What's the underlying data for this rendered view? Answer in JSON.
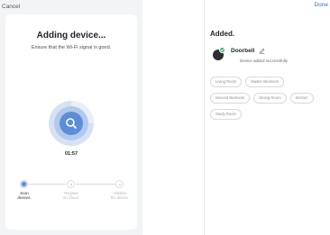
{
  "left_screen": {
    "cancel_label": "Cancel",
    "title": "Adding device...",
    "subtitle": "Ensure that the Wi-Fi signal is good.",
    "timer": "01:57",
    "progress_icon": "search-icon",
    "steps": [
      {
        "label_line1": "Scan",
        "label_line2": "devices.",
        "state": "active"
      },
      {
        "label_line1": "Register",
        "label_line2": "on Cloud.",
        "state": "pending"
      },
      {
        "label_line1": "Initialize",
        "label_line2": "the device.",
        "state": "pending"
      }
    ],
    "colors": {
      "accent": "#5b8ed6",
      "ring_outer": "#c7d7ef",
      "ring_inner": "#7aa3de"
    }
  },
  "right_screen": {
    "done_label": "Done",
    "added_title": "Added.",
    "device": {
      "name": "Doorbell",
      "status": "Device added successfully",
      "icon": "doorbell-icon",
      "badge_icon": "check-icon"
    },
    "rooms": [
      [
        "Living Room",
        "Master Bedroom"
      ],
      [
        "Second Bedroom",
        "Dining Room",
        "Kitchen"
      ],
      [
        "Study Room"
      ]
    ],
    "colors": {
      "link": "#3b6fd4",
      "success": "#2fb36b"
    }
  }
}
